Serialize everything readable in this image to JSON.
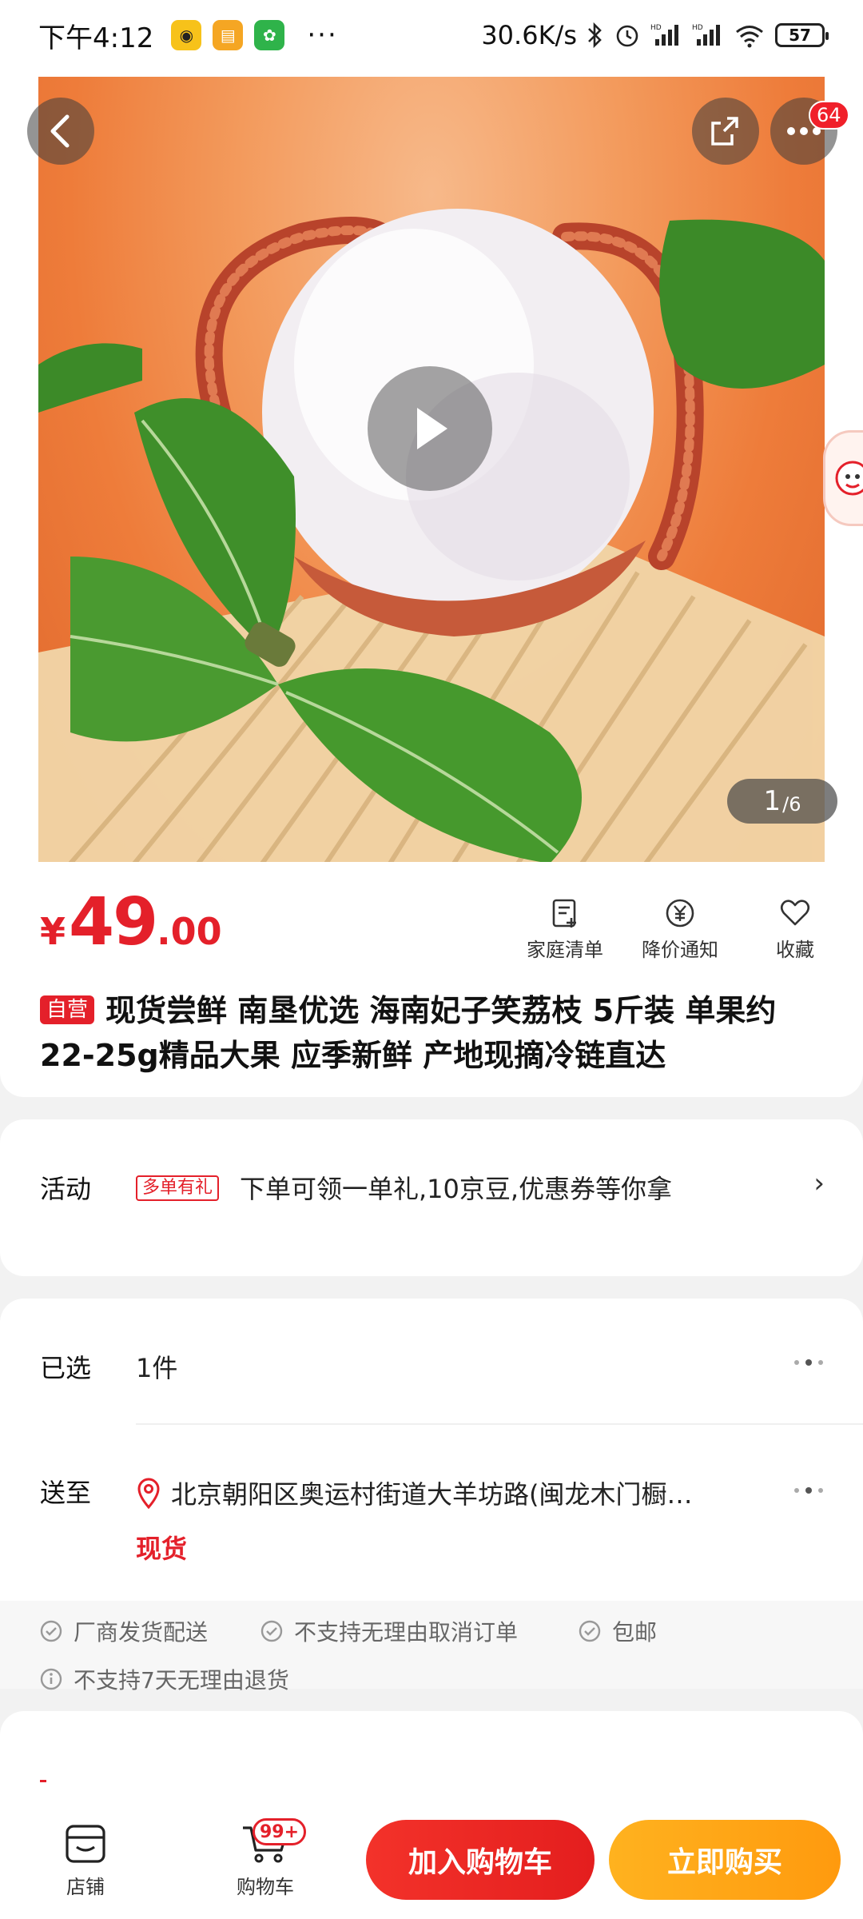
{
  "status_bar": {
    "time": "下午4:12",
    "speed": "30.6K/s",
    "battery": "57",
    "more": "···"
  },
  "hero": {
    "pager_current": "1",
    "pager_total": "/6",
    "more_badge": "64"
  },
  "product": {
    "price_symbol": "¥",
    "price_integer": "49",
    "price_decimal": ".00",
    "self_tag": "自营",
    "title": "现货尝鲜 南垦优选 海南妃子笑荔枝 5斤装 单果约22-25g精品大果 应季新鲜 产地现摘冷链直达",
    "actions": [
      {
        "label": "家庭清单",
        "icon": "list-add-icon"
      },
      {
        "label": "降价通知",
        "icon": "price-drop-icon"
      },
      {
        "label": "收藏",
        "icon": "heart-icon"
      }
    ]
  },
  "promo": {
    "label": "活动",
    "tag": "多单有礼",
    "text": "下单可领一单礼,10京豆,优惠券等你拿",
    "chevron": "›"
  },
  "selection": {
    "selected_label": "已选",
    "selected_value": "1件",
    "ship_label": "送至",
    "address": "北京朝阳区奥运村街道大羊坊路(闽龙木门橱…",
    "stock": "现货",
    "services": [
      "厂商发货配送",
      "不支持无理由取消订单",
      "包邮",
      "不支持7天无理由退货"
    ]
  },
  "bottom_bar": {
    "shop_label": "店铺",
    "cart_label": "购物车",
    "cart_badge": "99+",
    "add_cart": "加入购物车",
    "buy_now": "立即购买"
  },
  "colors": {
    "accent_red": "#e4202a",
    "buy_orange": "#ff9a0e"
  }
}
